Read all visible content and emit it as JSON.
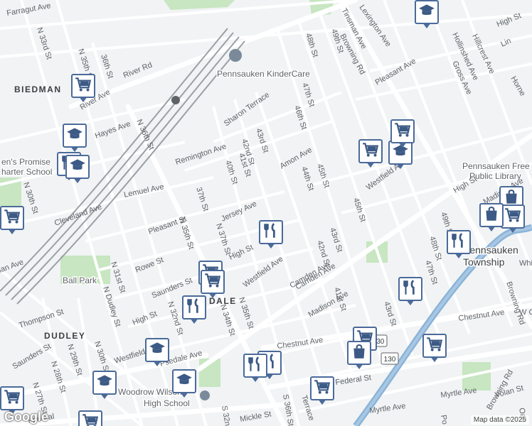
{
  "map": {
    "attribution": "Map data ©2025",
    "logo": "Google",
    "areas": [
      "BIEDMAN",
      "DUDLEY",
      "DALE"
    ],
    "pois": [
      "Pennsauken KinderCare",
      "Woodrow Wilson",
      "High School",
      "Ball Park",
      "Pennsauken Free",
      "Public Library",
      "Pennsauken",
      "Township",
      "en's Promise",
      "harter School"
    ],
    "roads": [
      "Farragut Ave",
      "N 33rd St",
      "N 35th St",
      "36th St",
      "River Rd",
      "River Ave",
      "Hayes Ave",
      "N 36th St",
      "Sharon Terrace",
      "Remington Ave",
      "43rd St",
      "42nd St",
      "41st St",
      "40th St",
      "Amon Ave",
      "Jersey Ave",
      "Lemuel Ave",
      "Cleveland Ave",
      "Pleasant St",
      "37th St",
      "N 35th St",
      "N 37th St",
      "High St",
      "Rowe St",
      "Saunders St",
      "N 31st St",
      "N Dudley St",
      "N 32nd St",
      "N 34th St",
      "N 35th St",
      "Thompson St",
      "High St",
      "Westfield Ave",
      "Westfield Ave",
      "Camden Ave",
      "44th St",
      "45th St",
      "46th St",
      "47th St",
      "48th St",
      "49th St",
      "Browning Rd",
      "Pleasant Ave",
      "Tinsman Ave",
      "Lexington Ave",
      "Gross Ave",
      "Hollinshed Ave",
      "Hillcrest Ave",
      "High St",
      "Madison Ave",
      "45th St",
      "43rd St",
      "42nd St",
      "41st St",
      "Camden Ave",
      "Madison Ave",
      "43rd St",
      "47th St",
      "48th St",
      "49th St",
      "Chestnut Ave",
      "Chestnut Ave",
      "Federal St",
      "Myrtle Ave",
      "Myrtle Ave",
      "Volan St",
      "Mickle St",
      "S 36th St",
      "S 32nd",
      "Terrace",
      "Browning Rd",
      "Browning Rd",
      "Westfield Ave",
      "Psedale Ave",
      "N 30th St",
      "N 29th St",
      "N 28th St",
      "N 27th St",
      "Saunders St",
      "Federal",
      "N 30th St",
      "Oak",
      "Po",
      "Whi",
      "W C",
      "Lin",
      "Horne",
      "High St",
      "ian Ave",
      "Oak"
    ],
    "shields": [
      "130",
      "130"
    ],
    "colors": {
      "background": "#f1f3f4",
      "road": "#ffffff",
      "highway": "#8ab4d8",
      "park": "#c7e6c1",
      "marker_border": "#4a6a9a",
      "rail": "#9aa0a6"
    },
    "markers": [
      {
        "icon": "education-icon"
      },
      {
        "icon": "grocery-cart-icon"
      },
      {
        "icon": "education-icon"
      },
      {
        "icon": "restaurant-icon"
      },
      {
        "icon": "education-icon"
      },
      {
        "icon": "grocery-cart-icon"
      },
      {
        "icon": "restaurant-icon"
      },
      {
        "icon": "grocery-cart-icon"
      },
      {
        "icon": "grocery-cart-icon"
      },
      {
        "icon": "restaurant-icon"
      },
      {
        "icon": "education-icon"
      },
      {
        "icon": "shopping-bag-icon"
      },
      {
        "icon": "grocery-cart-icon"
      },
      {
        "icon": "restaurant-icon"
      },
      {
        "icon": "restaurant-icon"
      },
      {
        "icon": "grocery-cart-icon"
      },
      {
        "icon": "shopping-bag-icon"
      },
      {
        "icon": "grocery-cart-icon"
      },
      {
        "icon": "grocery-cart-icon"
      },
      {
        "icon": "education-icon"
      },
      {
        "icon": "restaurant-icon"
      },
      {
        "icon": "grocery-cart-icon"
      },
      {
        "icon": "education-icon"
      },
      {
        "icon": "grocery-cart-icon"
      },
      {
        "icon": "grocery-cart-icon"
      },
      {
        "icon": "education-icon"
      },
      {
        "icon": "restaurant-icon"
      },
      {
        "icon": "shopping-bag-icon"
      },
      {
        "icon": "grocery-cart-icon"
      }
    ]
  }
}
